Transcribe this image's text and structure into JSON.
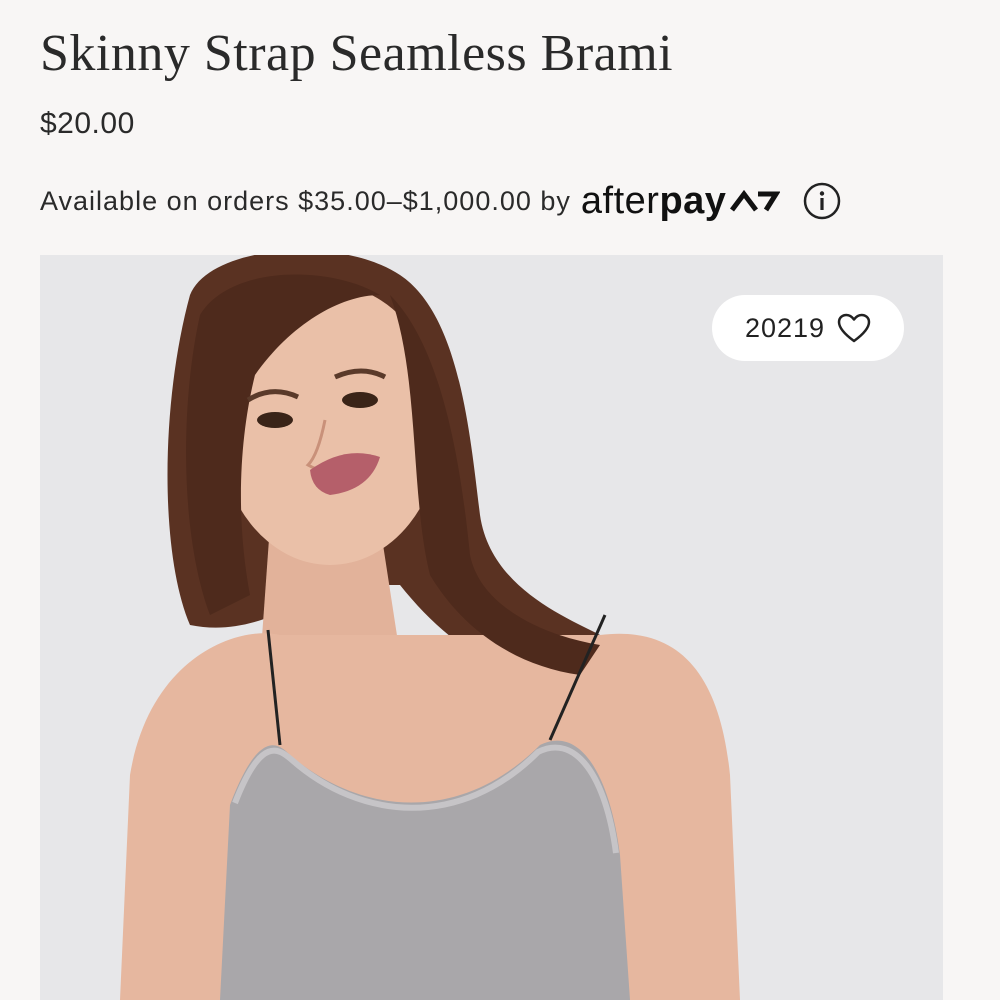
{
  "product": {
    "title": "Skinny Strap Seamless Brami",
    "price": "$20.00"
  },
  "afterpay": {
    "text": "Available on orders $35.00–$1,000.00 by",
    "logo_after": "after",
    "logo_pay": "pay",
    "logo_icon": "afterpay-arrows-icon",
    "info_icon": "info-icon"
  },
  "image": {
    "likes": "20219",
    "like_icon": "heart-icon",
    "background": "#e7e7e9"
  },
  "colors": {
    "page_background": "#f8f6f5",
    "text": "#2a2a2a"
  }
}
